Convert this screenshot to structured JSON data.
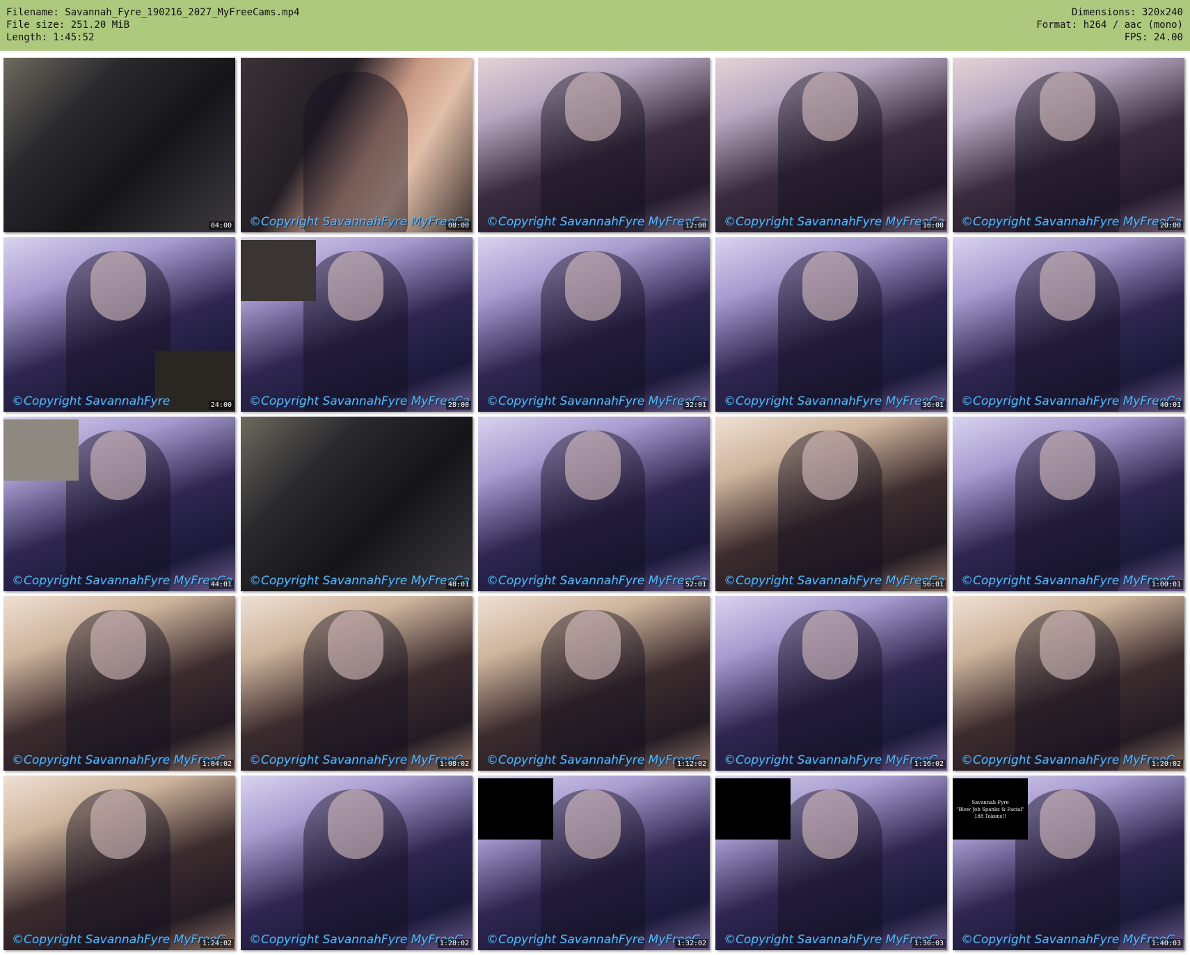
{
  "header": {
    "filename": "Filename: Savannah_Fyre_190216_2027_MyFreeCams.mp4",
    "file_size": "File size: 251.20 MiB",
    "length": "Length: 1:45:52",
    "dimensions": "Dimensions: 320x240",
    "format": "Format: h264 / aac (mono)",
    "fps": "FPS: 24.00"
  },
  "colors": {
    "header_bg": "#adc97e",
    "watermark": "#5db6ea"
  },
  "thumbnails": [
    {
      "time": "04:00",
      "watermark": "",
      "scene": "dark",
      "inset": ""
    },
    {
      "time": "08:00",
      "watermark": "©Copyright SavannahFyre MyFreeCa",
      "scene": "arm",
      "inset": ""
    },
    {
      "time": "12:00",
      "watermark": "©Copyright SavannahFyre MyFreeCa",
      "scene": "room",
      "inset": ""
    },
    {
      "time": "16:00",
      "watermark": "©Copyright SavannahFyre MyFreeCa",
      "scene": "room",
      "inset": ""
    },
    {
      "time": "20:00",
      "watermark": "©Copyright SavannahFyre MyFreeCa",
      "scene": "room",
      "inset": ""
    },
    {
      "time": "24:00",
      "watermark": "©Copyright SavannahFyre",
      "scene": "cool",
      "inset": "br"
    },
    {
      "time": "28:00",
      "watermark": "©Copyright SavannahFyre MyFreeCa",
      "scene": "cool",
      "inset": "tl"
    },
    {
      "time": "32:01",
      "watermark": "©Copyright SavannahFyre MyFreeCa",
      "scene": "cool",
      "inset": ""
    },
    {
      "time": "36:01",
      "watermark": "©Copyright SavannahFyre MyFreeCa",
      "scene": "cool",
      "inset": ""
    },
    {
      "time": "40:01",
      "watermark": "©Copyright SavannahFyre MyFreeCa",
      "scene": "cool",
      "inset": ""
    },
    {
      "time": "44:01",
      "watermark": "©Copyright SavannahFyre MyFreeCa",
      "scene": "cool",
      "inset": "tl-small"
    },
    {
      "time": "48:01",
      "watermark": "©Copyright SavannahFyre MyFreeCa",
      "scene": "dark",
      "inset": ""
    },
    {
      "time": "52:01",
      "watermark": "©Copyright SavannahFyre MyFreeCa",
      "scene": "cool",
      "inset": ""
    },
    {
      "time": "56:01",
      "watermark": "©Copyright SavannahFyre MyFreeCa",
      "scene": "warm",
      "inset": ""
    },
    {
      "time": "1:00:01",
      "watermark": "©Copyright SavannahFyre MyFreeC",
      "scene": "cool",
      "inset": ""
    },
    {
      "time": "1:04:02",
      "watermark": "©Copyright SavannahFyre MyFreeC",
      "scene": "warm",
      "inset": ""
    },
    {
      "time": "1:08:02",
      "watermark": "©Copyright SavannahFyre MyFreeC",
      "scene": "warm",
      "inset": ""
    },
    {
      "time": "1:12:02",
      "watermark": "©Copyright SavannahFyre MyFreeC",
      "scene": "warm",
      "inset": ""
    },
    {
      "time": "1:16:02",
      "watermark": "©Copyright SavannahFyre MyFreeC",
      "scene": "cool",
      "inset": ""
    },
    {
      "time": "1:20:02",
      "watermark": "©Copyright SavannahFyre MyFreeC",
      "scene": "warm",
      "inset": ""
    },
    {
      "time": "1:24:02",
      "watermark": "©Copyright SavannahFyre MyFreeC",
      "scene": "warm",
      "inset": ""
    },
    {
      "time": "1:28:02",
      "watermark": "©Copyright SavannahFyre MyFreeC",
      "scene": "cool",
      "inset": ""
    },
    {
      "time": "1:32:02",
      "watermark": "©Copyright SavannahFyre MyFreeC",
      "scene": "cool",
      "inset": "black"
    },
    {
      "time": "1:36:03",
      "watermark": "©Copyright SavannahFyre MyFreeC",
      "scene": "cool",
      "inset": "black"
    },
    {
      "time": "1:40:03",
      "watermark": "©Copyright SavannahFyre MyFreeC",
      "scene": "cool",
      "inset": "promo"
    }
  ],
  "promo_inset": {
    "line1": "Savannah Fyre",
    "line2": "\"Blow Job Spanks & Facial\"",
    "line3": "188 Tokens!!"
  }
}
